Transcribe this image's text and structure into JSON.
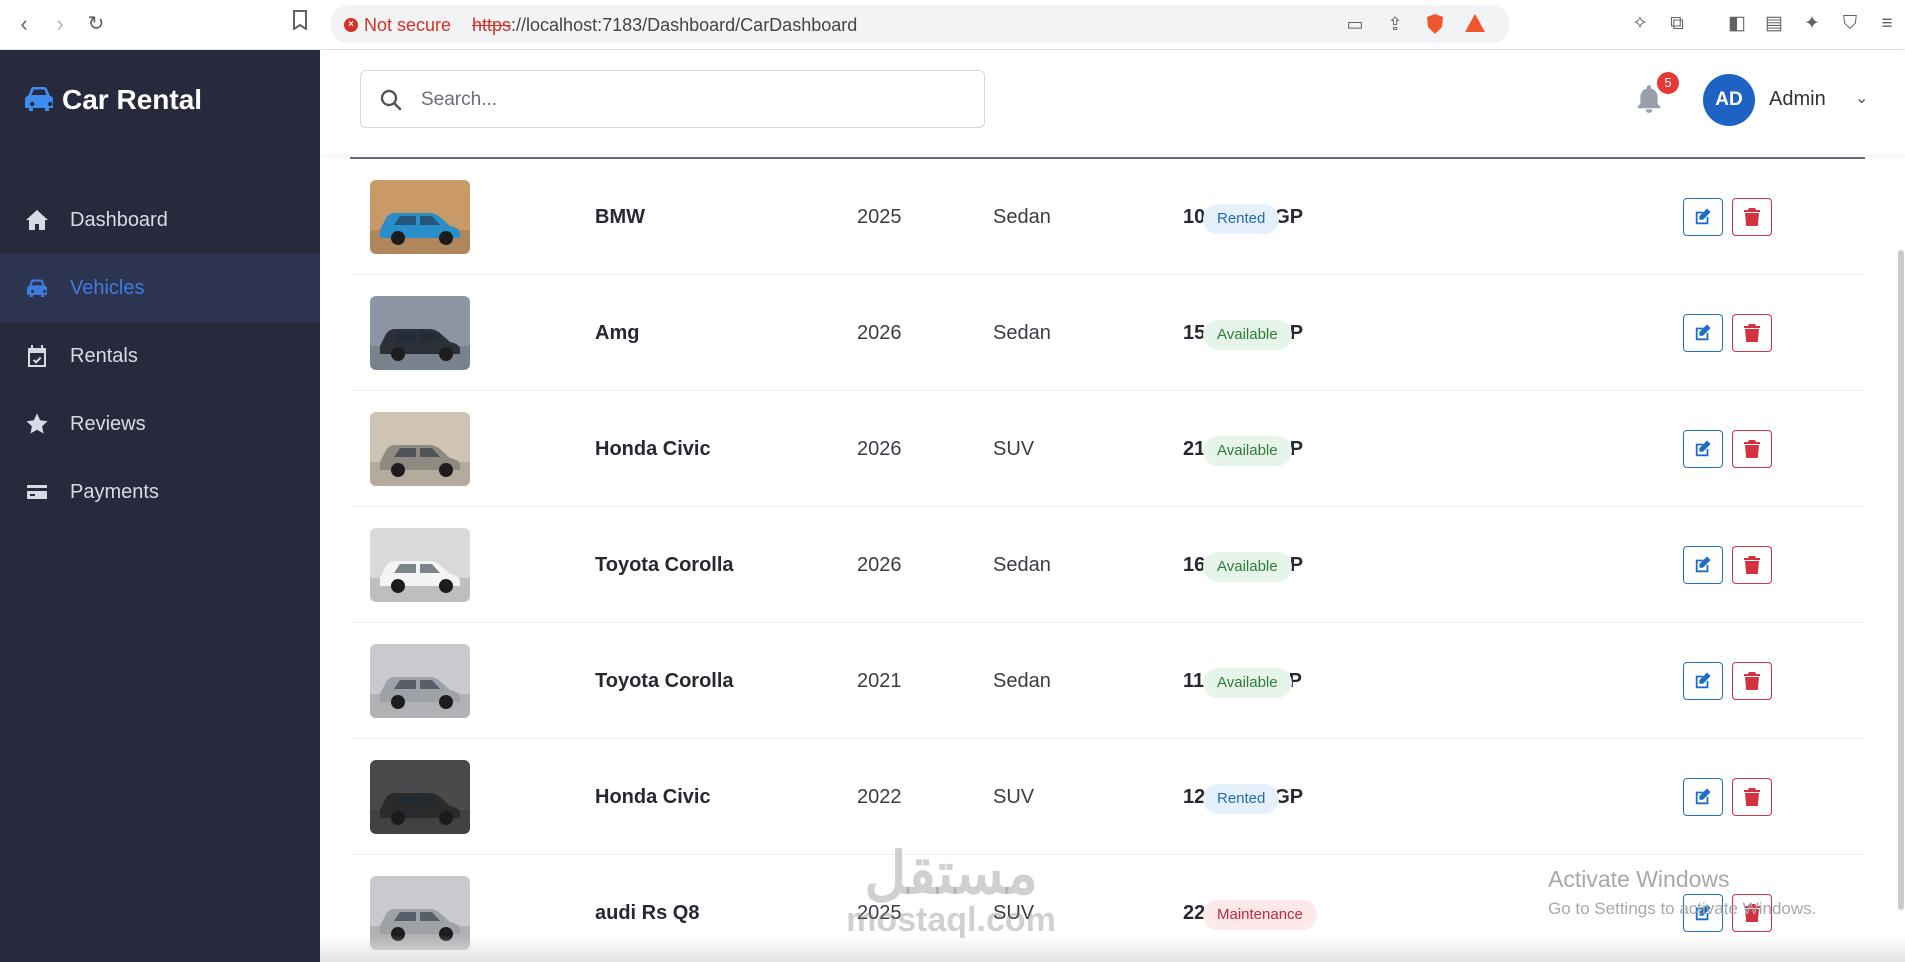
{
  "browser": {
    "security_label": "Not secure",
    "url_proto": "https",
    "url_rest": "://localhost:7183/Dashboard/CarDashboard"
  },
  "sidebar": {
    "brand": "Car Rental",
    "items": [
      {
        "label": "Dashboard",
        "icon": "home-icon",
        "active": false
      },
      {
        "label": "Vehicles",
        "icon": "car-icon",
        "active": true
      },
      {
        "label": "Rentals",
        "icon": "calendar-check-icon",
        "active": false
      },
      {
        "label": "Reviews",
        "icon": "star-icon",
        "active": false
      },
      {
        "label": "Payments",
        "icon": "credit-card-icon",
        "active": false
      }
    ]
  },
  "header": {
    "search_placeholder": "Search...",
    "notification_count": "5",
    "avatar_initials": "AD",
    "user_name": "Admin"
  },
  "vehicles": [
    {
      "make": "BMW",
      "year": "2025",
      "type": "Sedan",
      "price": "1000.00 EGP",
      "status": "Rented",
      "status_class": "rented",
      "thumb_color": "#2a8fc9",
      "thumb_bg": "#c99a67"
    },
    {
      "make": "Amg",
      "year": "2026",
      "type": "Sedan",
      "price": "1500.00 EGP",
      "status": "Available",
      "status_class": "available",
      "thumb_color": "#2b2f38",
      "thumb_bg": "#8b95a3"
    },
    {
      "make": "Honda Civic",
      "year": "2026",
      "type": "SUV",
      "price": "2100.00 EGP",
      "status": "Available",
      "status_class": "available",
      "thumb_color": "#8e8a82",
      "thumb_bg": "#cfc3b3"
    },
    {
      "make": "Toyota Corolla",
      "year": "2026",
      "type": "Sedan",
      "price": "1600.00 EGP",
      "status": "Available",
      "status_class": "available",
      "thumb_color": "#f4f4f4",
      "thumb_bg": "#d9d9d9"
    },
    {
      "make": "Toyota Corolla",
      "year": "2021",
      "type": "Sedan",
      "price": "1100.00 EGP",
      "status": "Available",
      "status_class": "available",
      "thumb_color": "#9ea1a6",
      "thumb_bg": "#c8cacd"
    },
    {
      "make": "Honda Civic",
      "year": "2022",
      "type": "SUV",
      "price": "1200.00 EGP",
      "status": "Rented",
      "status_class": "rented",
      "thumb_color": "#2a2a2c",
      "thumb_bg": "#4a4a4d"
    },
    {
      "make": "audi Rs Q8",
      "year": "2025",
      "type": "SUV",
      "price": "2200.00 EGP",
      "status": "Maintenance",
      "status_class": "maintenance",
      "thumb_color": "#9ea1a6",
      "thumb_bg": "#c8cacd"
    }
  ],
  "overlay": {
    "activate_title": "Activate Windows",
    "activate_sub": "Go to Settings to activate Windows.",
    "watermark_ar": "مستقل",
    "watermark_en": "mostaql.com"
  }
}
